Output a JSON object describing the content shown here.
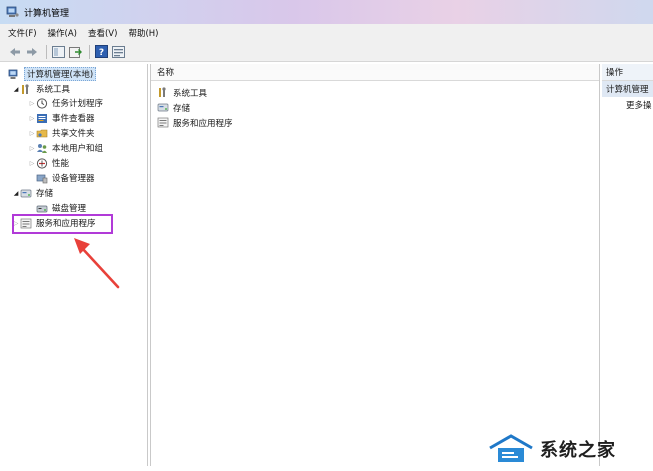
{
  "window": {
    "title": "计算机管理"
  },
  "menubar": {
    "items": [
      "文件(F)",
      "操作(A)",
      "查看(V)",
      "帮助(H)"
    ]
  },
  "toolbar": {
    "buttons": [
      "back-icon",
      "forward-icon",
      "show-hide-tree-icon",
      "export-list-icon",
      "help-icon",
      "properties-icon"
    ]
  },
  "tree": {
    "root": "计算机管理(本地)",
    "items": [
      {
        "label": "系统工具",
        "icon": "tools-icon",
        "expanded": true
      },
      {
        "label": "任务计划程序",
        "icon": "clock-icon"
      },
      {
        "label": "事件查看器",
        "icon": "event-viewer-icon"
      },
      {
        "label": "共享文件夹",
        "icon": "shared-folder-icon"
      },
      {
        "label": "本地用户和组",
        "icon": "users-icon"
      },
      {
        "label": "性能",
        "icon": "performance-icon"
      },
      {
        "label": "设备管理器",
        "icon": "device-manager-icon"
      },
      {
        "label": "存储",
        "icon": "storage-icon",
        "expanded": true
      },
      {
        "label": "磁盘管理",
        "icon": "disk-icon"
      },
      {
        "label": "服务和应用程序",
        "icon": "services-icon",
        "highlighted": true
      }
    ]
  },
  "list": {
    "column_header": "名称",
    "rows": [
      "系统工具",
      "存储",
      "服务和应用程序"
    ]
  },
  "actions": {
    "header": "操作",
    "section_title": "计算机管理",
    "more": "更多操"
  },
  "annotation": {
    "highlight_color": "#b13ad8",
    "arrow_color": "#e8413a"
  },
  "watermark": {
    "text": "系统之家"
  }
}
